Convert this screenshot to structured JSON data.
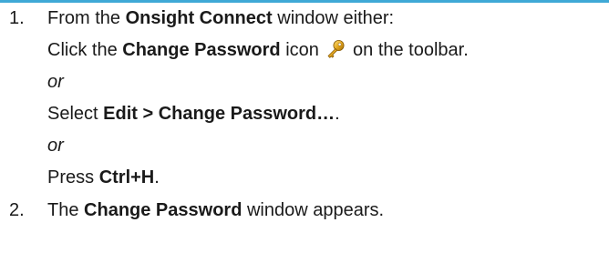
{
  "steps": [
    {
      "number": "1.",
      "intro_prefix": "From the ",
      "intro_bold": "Onsight Connect",
      "intro_suffix": " window either:",
      "options": {
        "click_prefix": "Click the ",
        "click_bold": "Change Password",
        "click_middle": " icon ",
        "click_suffix": " on the toolbar.",
        "or_1": "or",
        "select_prefix": "Select ",
        "select_bold": "Edit > Change Password…",
        "select_suffix": ".",
        "or_2": "or",
        "press_prefix": "Press ",
        "press_bold": "Ctrl+H",
        "press_suffix": "."
      }
    },
    {
      "number": "2.",
      "prefix": "The ",
      "bold": "Change Password",
      "suffix": " window appears."
    }
  ],
  "icons": {
    "change_password": "key-icon"
  },
  "colors": {
    "top_rule": "#3fa9d6",
    "key_gold": "#e0a21a"
  }
}
